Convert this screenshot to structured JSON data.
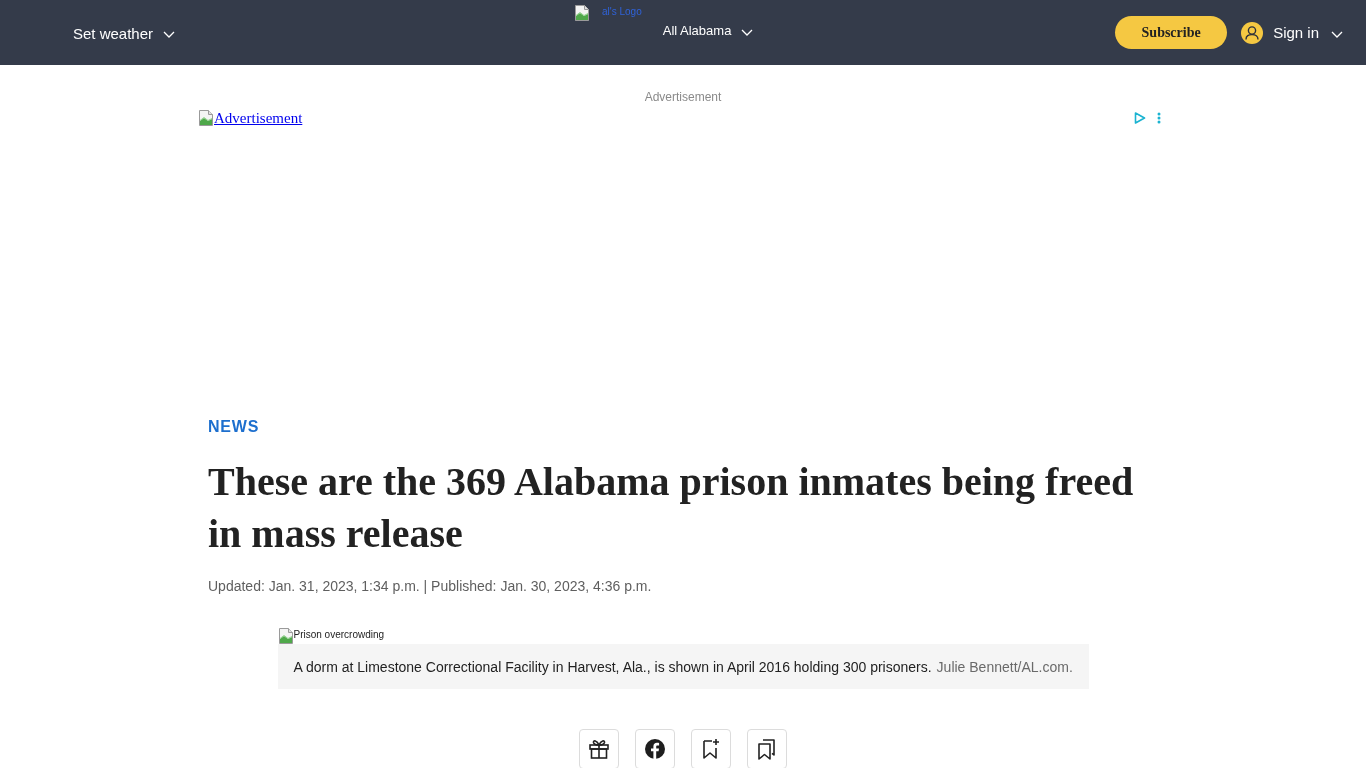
{
  "header": {
    "weather": {
      "label": "Set weather"
    },
    "logo": {
      "alt": "al's Logo"
    },
    "region": {
      "label": "All Alabama"
    },
    "subscribe": {
      "label": "Subscribe"
    },
    "sign_in": {
      "label": "Sign in"
    }
  },
  "ad": {
    "label": "Advertisement",
    "link": "Advertisement"
  },
  "article": {
    "section": "NEWS",
    "headline": "These are the 369 Alabama prison inmates being freed in mass release",
    "dates": "Updated: Jan. 31, 2023, 1:34 p.m. | Published: Jan. 30, 2023, 4:36 p.m.",
    "image": {
      "alt": "Prison overcrowding",
      "caption": "A dorm at Limestone Correctional Facility in Harvest, Ala., is shown in April 2016 holding 300 prisoners.",
      "credit": "Julie Bennett/AL.com."
    }
  },
  "share_buttons": [
    {
      "kind": "gift"
    },
    {
      "kind": "facebook"
    },
    {
      "kind": "bookmark_add"
    },
    {
      "kind": "bookmarks"
    }
  ]
}
